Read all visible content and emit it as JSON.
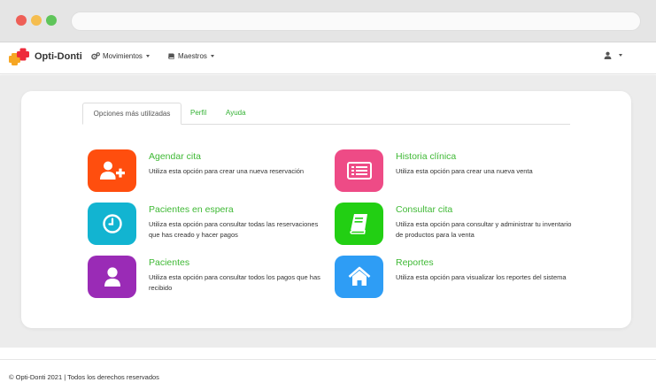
{
  "navbar": {
    "brand": "Opti-Donti",
    "menus": [
      {
        "label": "Movimientos",
        "icon": "gears-icon"
      },
      {
        "label": "Maestros",
        "icon": "book-icon"
      }
    ],
    "user_icon": "user-icon"
  },
  "tabs": [
    {
      "label": "Opciones más utilizadas",
      "active": true
    },
    {
      "label": "Perfil",
      "active": false
    },
    {
      "label": "Ayuda",
      "active": false
    }
  ],
  "options": [
    {
      "title": "Agendar cita",
      "description": "Utiliza esta opción para crear una nueva reservación",
      "icon": "user-plus-icon",
      "color": "#ff4e0e"
    },
    {
      "title": "Historia clínica",
      "description": "Utiliza esta opción para crear una nueva venta",
      "icon": "list-card-icon",
      "color": "#ee4b86"
    },
    {
      "title": "Pacientes en espera",
      "description": "Utiliza esta opción para consultar todas las reservaciones que has creado y hacer pagos",
      "icon": "clock-icon",
      "color": "#12b4d1"
    },
    {
      "title": "Consultar cita",
      "description": "Utiliza esta opción para consultar y administrar tu inventario de productos para la venta",
      "icon": "book-icon",
      "color": "#22cf13"
    },
    {
      "title": "Pacientes",
      "description": "Utiliza esta opción para consultar todos los pagos que has recibido",
      "icon": "user-icon",
      "color": "#9a2bb6"
    },
    {
      "title": "Reportes",
      "description": "Utiliza esta opción para visualizar los reportes del sistema",
      "icon": "home-icon",
      "color": "#2e9df5"
    }
  ],
  "colors": {
    "accent": "#3fb935",
    "background": "#ececec"
  },
  "footer": {
    "text": "© Opti-Donti 2021 | Todos los derechos reservados"
  }
}
